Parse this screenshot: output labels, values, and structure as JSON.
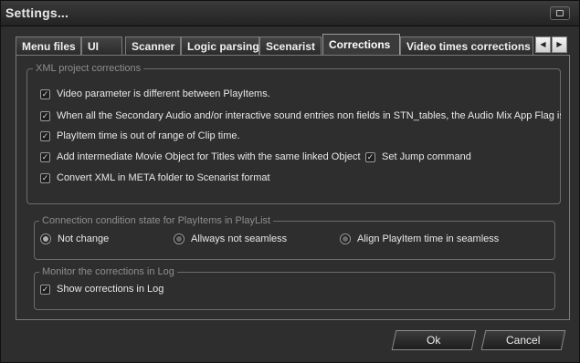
{
  "window": {
    "title": "Settings..."
  },
  "tabs": [
    {
      "label": "Menu files",
      "active": false
    },
    {
      "label": "UI",
      "active": false
    },
    {
      "label": "Scanner",
      "active": false
    },
    {
      "label": "Logic parsing",
      "active": false
    },
    {
      "label": "Scenarist",
      "active": false
    },
    {
      "label": "Corrections",
      "active": true
    },
    {
      "label": "Video times corrections",
      "active": false
    }
  ],
  "tab_scroll": {
    "left_icon": "◀",
    "right_icon": "▶"
  },
  "xml_group": {
    "legend": "XML project corrections",
    "items": [
      {
        "label": "Video parameter is different between PlayItems.",
        "checked": true
      },
      {
        "label": "When all the Secondary Audio and/or interactive sound entries non fields in STN_tables, the Audio Mix App Flag is se",
        "checked": true
      },
      {
        "label": "PlayItem time is out of range of Clip time.",
        "checked": true
      },
      {
        "label": "Add intermediate Movie Object for Titles with the same linked Object",
        "checked": true
      },
      {
        "label": "Set Jump command",
        "checked": true
      },
      {
        "label": "Convert XML in META folder to Scenarist format",
        "checked": true
      }
    ]
  },
  "connection_group": {
    "legend": "Connection condition state for PlayItems in PlayList",
    "options": [
      {
        "label": "Not change",
        "selected": true
      },
      {
        "label": "Allways not seamless",
        "selected": false
      },
      {
        "label": "Align PlayItem time in seamless",
        "selected": false
      }
    ]
  },
  "monitor_group": {
    "legend": "Monitor the corrections in Log",
    "items": [
      {
        "label": "Show corrections in Log",
        "checked": true
      }
    ]
  },
  "buttons": {
    "ok": "Ok",
    "cancel": "Cancel"
  },
  "glyphs": {
    "check": "✓"
  }
}
